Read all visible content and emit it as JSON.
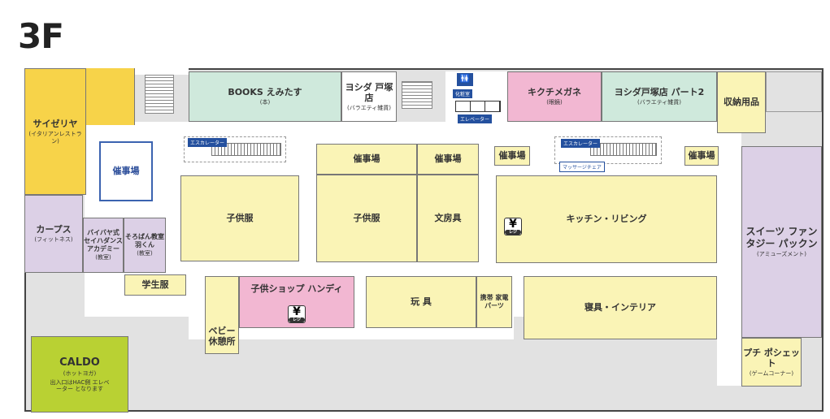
{
  "floor": "3F",
  "stores": {
    "saizeriya": {
      "name": "サイゼリヤ",
      "sub": "(イタリアンレストラン)"
    },
    "curves": {
      "name": "カープス",
      "sub": "(フィットネス)"
    },
    "bybaiya": {
      "name": "バイバヤ式 セイハダンス アカデミー",
      "sub": "(教室)"
    },
    "soroban": {
      "name": "そろばん教室 羽くん",
      "sub": "(教室)"
    },
    "gakuseifuku": {
      "name": "学生服"
    },
    "caldo": {
      "name": "CALDO",
      "sub": "(ホットヨガ)",
      "note": "出入口はHAC側 エレベーター となります"
    },
    "books": {
      "name": "BOOKS えみたす",
      "sub": "(本)"
    },
    "yoshida1": {
      "name": "ヨシダ 戸塚店",
      "sub": "(バラエティ雑貨)"
    },
    "kikuchi": {
      "name": "キクチメガネ",
      "sub": "(眼鏡)"
    },
    "yoshida2": {
      "name": "ヨシダ戸塚店 パート2",
      "sub": "(バラエティ雑貨)"
    },
    "shuno": {
      "name": "収納用品"
    },
    "sweets": {
      "name": "スイーツ ファンタジー パックン",
      "sub": "(アミューズメント)"
    },
    "puchi": {
      "name": "プチ ポシェット",
      "sub": "(ゲームコーナー)"
    },
    "event_left": {
      "name": "催事場"
    },
    "event_a": {
      "name": "催事場"
    },
    "event_b": {
      "name": "催事場"
    },
    "event_c": {
      "name": "催事場"
    },
    "event_d": {
      "name": "催事場"
    },
    "kodomo1": {
      "name": "子供服"
    },
    "kodomo2": {
      "name": "子供服"
    },
    "bunbogu": {
      "name": "文房具"
    },
    "kitchen": {
      "name": "キッチン・リビング"
    },
    "handy": {
      "name": "子供ショップ ハンディ"
    },
    "baby": {
      "name": "ベビー 休憩所"
    },
    "toys": {
      "name": "玩 具"
    },
    "keitai": {
      "name": "携帯 家電 パーツ"
    },
    "shingu": {
      "name": "寝具・インテリア"
    }
  },
  "facilities": {
    "escalator": "エスカレーター",
    "elevator": "エレベーター",
    "restroom": "化粧室",
    "massage": "マッサージチェア",
    "register": "レジ",
    "yen_symbol": "¥"
  },
  "colors": {
    "yellow": "#faf4b6",
    "green": "#cfe9dc",
    "pink": "#f2b7d2",
    "purple": "#dcd0e6",
    "gold": "#f7d349",
    "lime": "#b9d133",
    "corridor": "#e2e2e2",
    "tag_blue": "#24509e"
  }
}
